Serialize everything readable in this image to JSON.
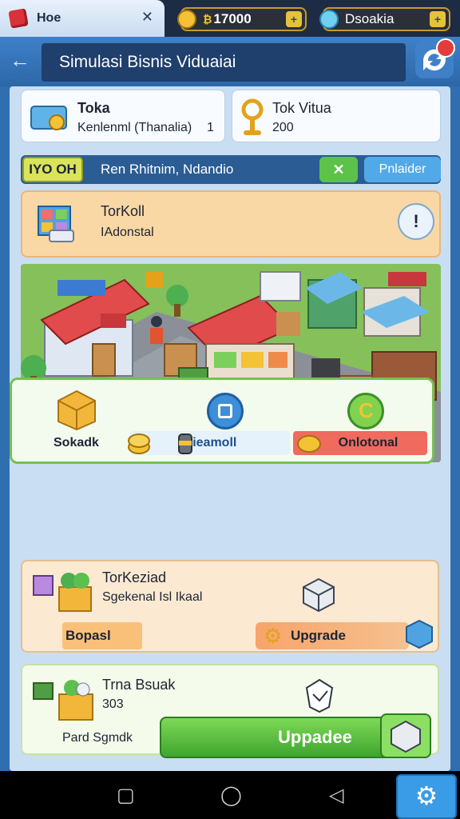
{
  "tabs": {
    "home_label": "Hoe",
    "close_glyph": "✕"
  },
  "resources": [
    {
      "icon": "gear-coin-icon",
      "value": "17000",
      "prefix": "₿",
      "plus": "+"
    },
    {
      "icon": "diamond-icon",
      "value": "Dsoakia",
      "plus": "+"
    }
  ],
  "header": {
    "back_glyph": "←",
    "title": "Simulasi Bisnis Viduaiai"
  },
  "stats": {
    "left": {
      "title": "Toka",
      "line": "Kenlenml (Thanalia)",
      "value": "1"
    },
    "right": {
      "title": "Tok Vitua",
      "value": "200"
    }
  },
  "level": {
    "badge": "IYO OH",
    "text": "Ren Rhitnim, Ndandio",
    "action_glyph": "✕",
    "button": "Pnlaider"
  },
  "shop": {
    "title": "TorKoll",
    "subtitle": "IAdonstal",
    "info_glyph": "!"
  },
  "production": {
    "items": [
      {
        "label": "Sokadk"
      },
      {
        "label": "Dieamoll"
      },
      {
        "label": "Onlotonal"
      }
    ]
  },
  "building1": {
    "title": "TorKeziad",
    "subtitle": "Sgekenal Isl Ikaal",
    "left_button": "Bopasl",
    "upgrade": "Upgrade"
  },
  "building2": {
    "title": "Trna Bsuak",
    "value": "303",
    "footer": "Pard Sgmdk"
  },
  "big_upgrade": "Uppadee",
  "nav": {
    "square": "▢",
    "circle": "◯",
    "back": "◁",
    "settings": "⚙"
  },
  "colors": {
    "accent_blue": "#3f80c8",
    "green": "#5cc24a",
    "orange": "#f8a46b"
  }
}
